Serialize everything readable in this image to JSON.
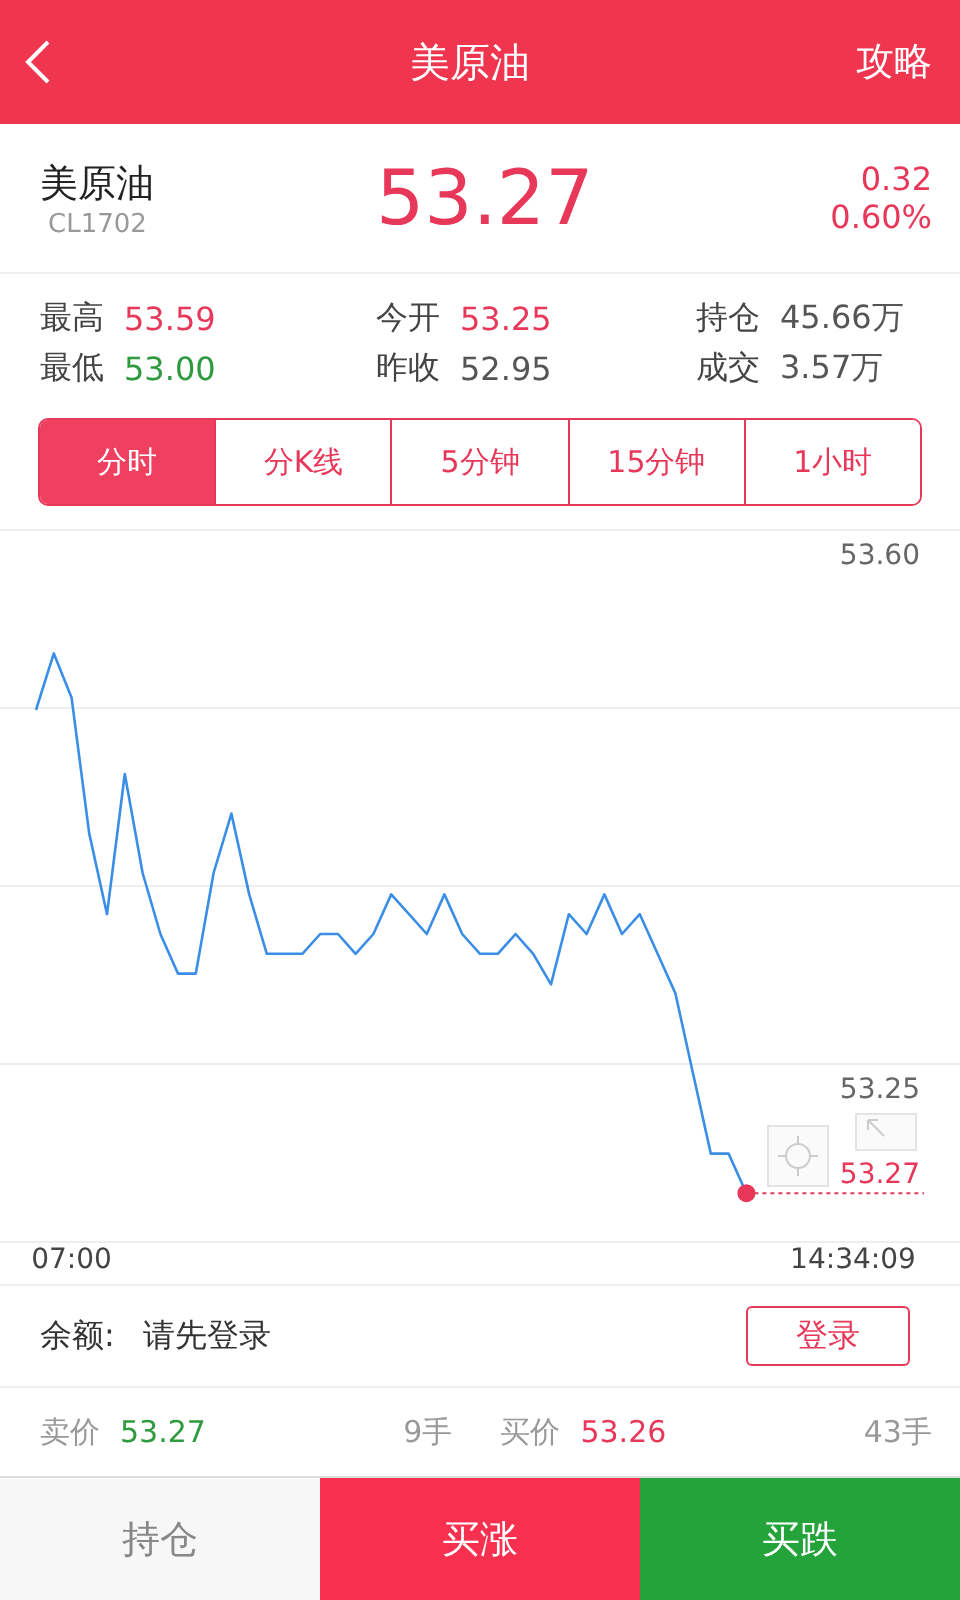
{
  "header": {
    "title": "美原油",
    "action": "攻略"
  },
  "quote": {
    "name": "美原油",
    "code": "CL1702",
    "price": "53.27",
    "change": "0.32",
    "change_pct": "0.60%"
  },
  "stats": [
    {
      "label": "最高",
      "value": "53.59",
      "color": "#e8385a"
    },
    {
      "label": "今开",
      "value": "53.25",
      "color": "#e8385a"
    },
    {
      "label": "持仓",
      "value": "45.66万",
      "color": "#555555"
    },
    {
      "label": "最低",
      "value": "53.00",
      "color": "#2f9a3e"
    },
    {
      "label": "昨收",
      "value": "52.95",
      "color": "#555555"
    },
    {
      "label": "成交",
      "value": "3.57万",
      "color": "#555555"
    }
  ],
  "tabs": [
    {
      "label": "分时",
      "selected": true
    },
    {
      "label": "分K线",
      "selected": false
    },
    {
      "label": "5分钟",
      "selected": false
    },
    {
      "label": "15分钟",
      "selected": false
    },
    {
      "label": "1小时",
      "selected": false
    }
  ],
  "chart": {
    "current_price": "53.27",
    "chart_data": {
      "type": "line",
      "ylim": [
        53.133,
        53.6
      ],
      "categories": [
        null,
        null,
        "07:00",
        null,
        null,
        null,
        null,
        null,
        null,
        null,
        null,
        null,
        null,
        null,
        null,
        null,
        null,
        null,
        null,
        null,
        null,
        null,
        null,
        null,
        null,
        null,
        null,
        null,
        null,
        null,
        null,
        null,
        null,
        null,
        null,
        null,
        null,
        null,
        null,
        null,
        null,
        null,
        null,
        null,
        null,
        null,
        "14:34:09",
        null,
        null,
        null,
        null
      ],
      "yticks": [
        {
          "value": 53.6,
          "label": "53.60"
        },
        {
          "value": 53.25,
          "label": "53.25"
        }
      ],
      "series": [
        {
          "color": "#3a8ee6",
          "values": [
            53.482,
            53.519,
            53.49,
            53.401,
            53.348,
            53.44,
            53.375,
            53.335,
            53.309,
            53.309,
            53.375,
            53.414,
            53.361,
            53.322,
            53.322,
            53.322,
            53.335,
            53.335,
            53.322,
            53.335,
            53.361,
            53.348,
            53.335,
            53.361,
            53.335,
            53.322,
            53.322,
            53.335,
            53.322,
            53.302,
            53.348,
            53.335,
            53.361,
            53.335,
            53.348,
            53.322,
            53.296,
            53.243,
            53.191,
            53.191,
            53.165,
            null,
            null,
            null,
            null,
            null,
            null,
            null,
            null,
            null,
            null
          ]
        }
      ]
    }
  },
  "balance": {
    "label": "余额:",
    "value": "请先登录",
    "button": "登录"
  },
  "depth": {
    "sell_label": "卖价",
    "sell_price": "53.27",
    "sell_qty": "9手",
    "buy_label": "买价",
    "buy_price": "53.26",
    "buy_qty": "43手"
  },
  "actions": [
    {
      "label": "持仓",
      "kind": "plain"
    },
    {
      "label": "买涨",
      "kind": "up"
    },
    {
      "label": "买跌",
      "kind": "down"
    }
  ]
}
